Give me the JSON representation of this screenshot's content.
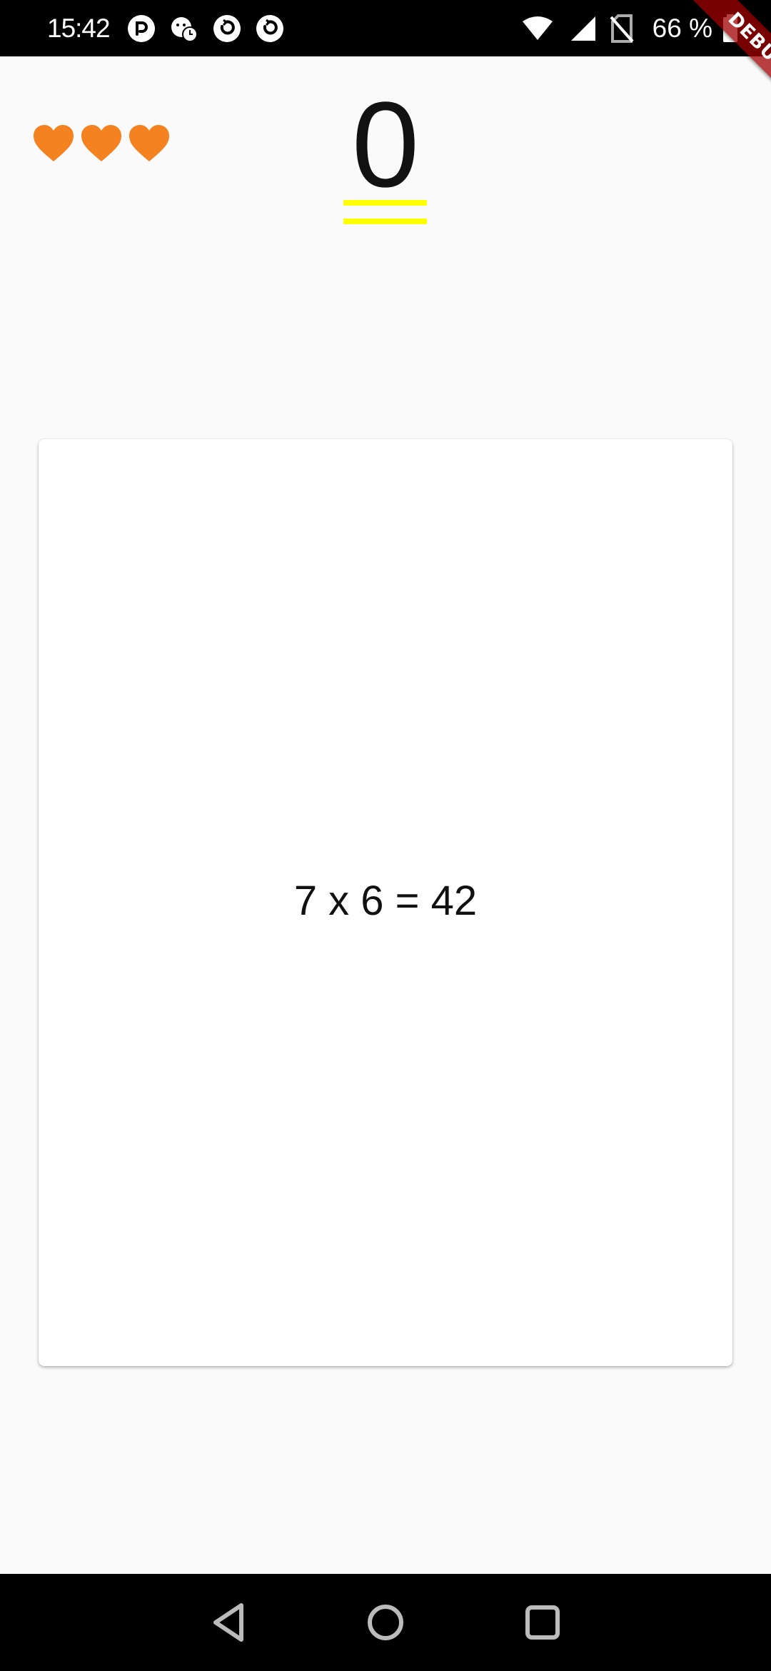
{
  "status_bar": {
    "time": "15:42",
    "notification_icons": [
      "pocket-casts-icon",
      "mood-tracker-icon",
      "sync-icon",
      "sync-icon"
    ],
    "system_icons": [
      "wifi-icon",
      "signal-icon",
      "no-sim-icon"
    ],
    "battery_text": "66 %",
    "background": "#000000"
  },
  "debug_banner": {
    "label": "DEBUG"
  },
  "game": {
    "lives": 3,
    "heart_color": "#f58220",
    "score": "0",
    "underline_color": "#ffff00",
    "question": "7 x 6 = 42"
  },
  "nav_bar": {
    "buttons": [
      "back",
      "home",
      "recents"
    ]
  }
}
